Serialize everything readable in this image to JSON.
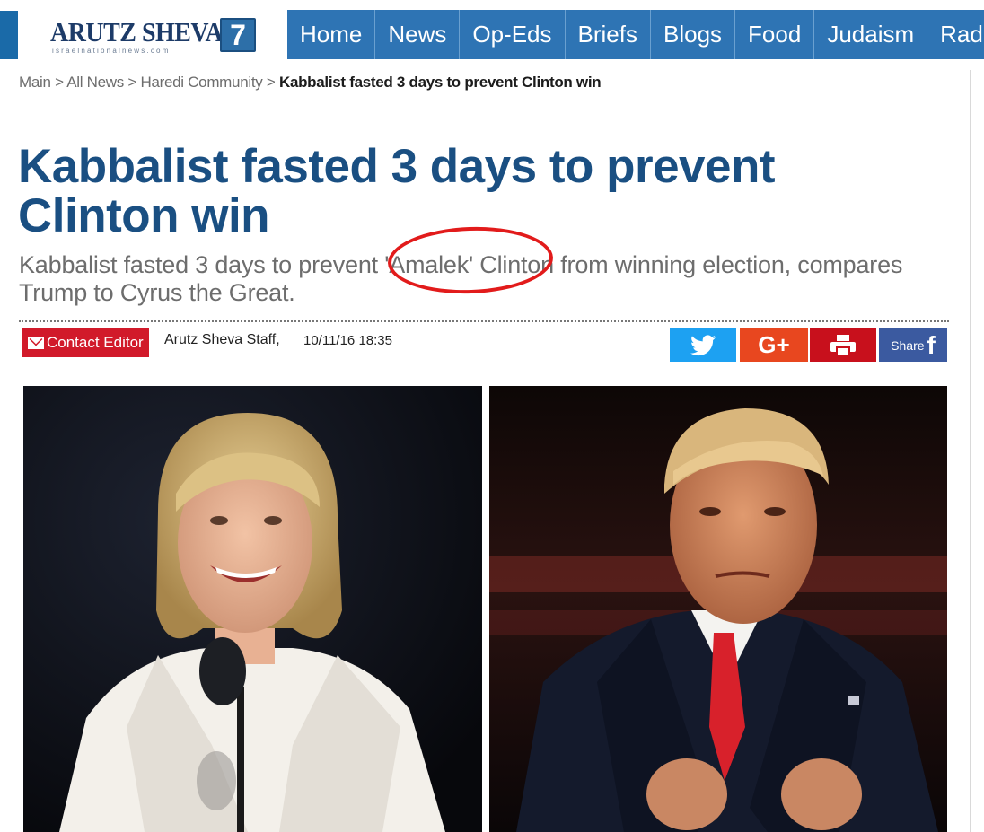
{
  "header": {
    "logo_text": "ARUTZ SHEVA",
    "logo_number": "7",
    "logo_sub": "israelnationalnews.com",
    "nav": [
      "Home",
      "News",
      "Op-Eds",
      "Briefs",
      "Blogs",
      "Food",
      "Judaism",
      "Radio"
    ]
  },
  "breadcrumb": {
    "items": [
      "Main",
      "All News",
      "Haredi Community"
    ],
    "separator": ">",
    "current": "Kabbalist fasted 3 days to prevent Clinton win"
  },
  "article": {
    "title": "Kabbalist fasted 3 days to prevent Clinton win",
    "subtitle": "Kabbalist fasted 3 days to prevent 'Amalek' Clinton from winning election, compares Trump to Cyrus the Great.",
    "contact_label": "Contact Editor",
    "author": "Arutz Sheva Staff,",
    "date": "10/11/16 18:35"
  },
  "share": {
    "plus_label": "G+",
    "share_label": "Share",
    "fb_letter": "f"
  },
  "colors": {
    "nav_bg": "#2e74b4",
    "title": "#1a4f82",
    "contact": "#d11a2a",
    "twitter": "#1da1f2",
    "gplus": "#e8471f",
    "print": "#c8101c",
    "facebook": "#3b5aa0",
    "annotation": "#e21b1b"
  },
  "icons": [
    "mail-icon",
    "twitter-icon",
    "print-icon",
    "facebook-icon"
  ]
}
